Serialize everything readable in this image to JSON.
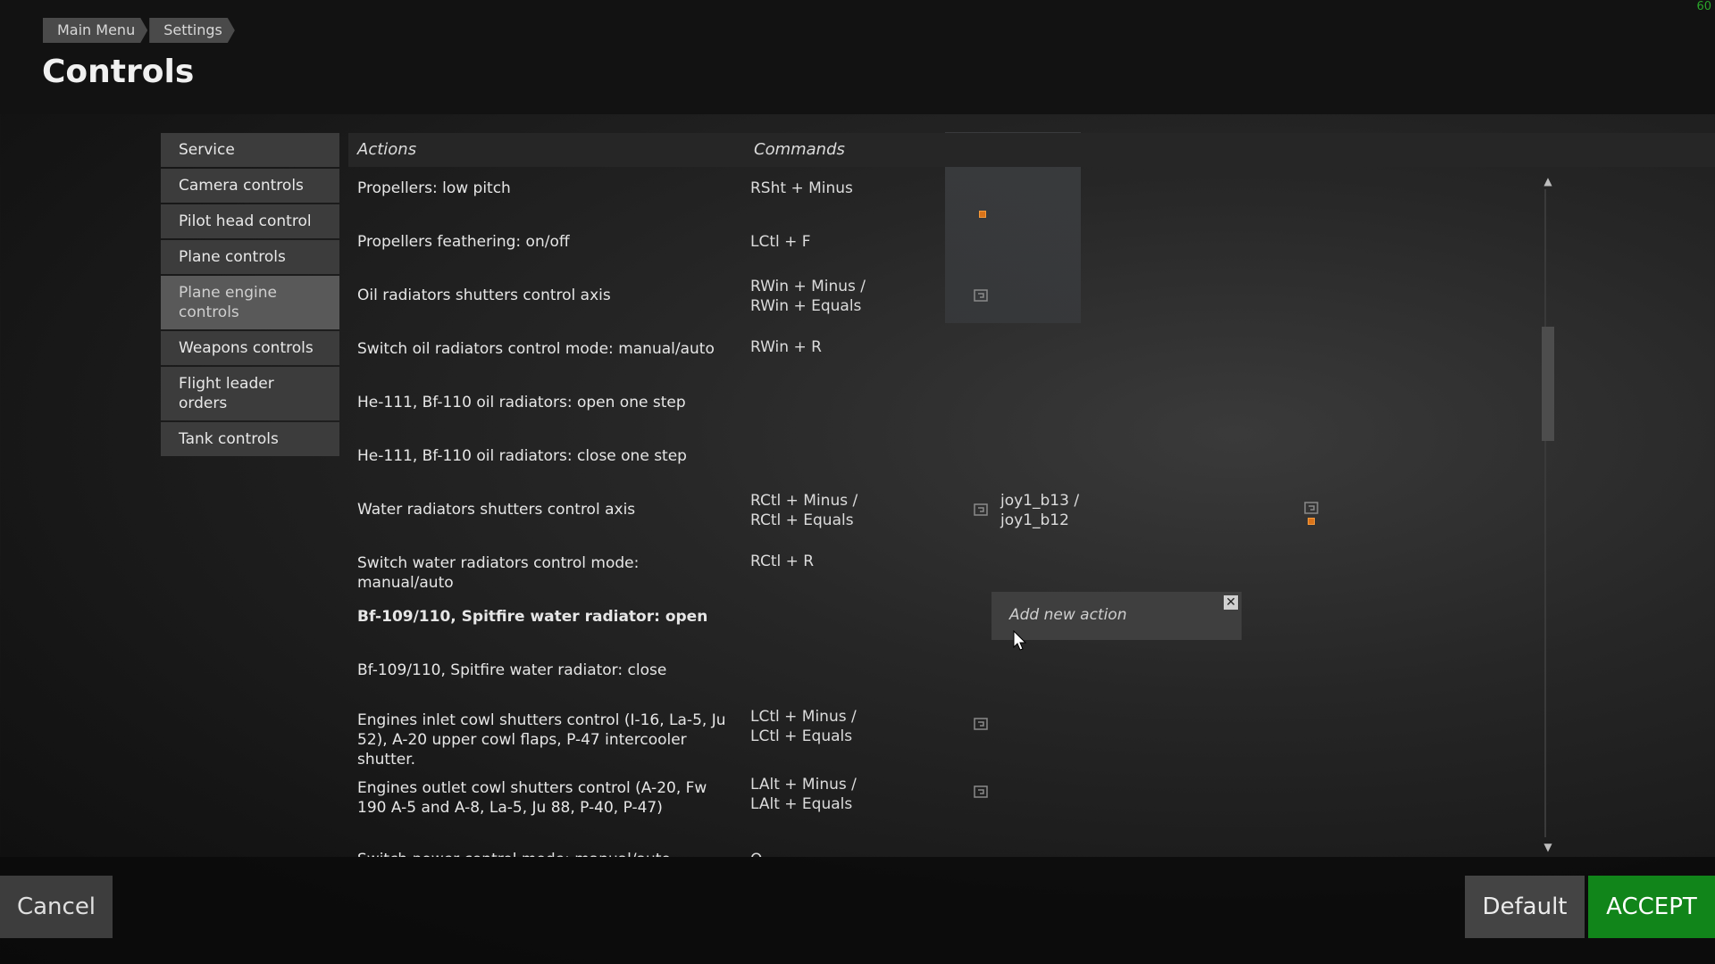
{
  "fps": "60",
  "breadcrumb": [
    "Main Menu",
    "Settings"
  ],
  "title": "Controls",
  "sidebar": [
    {
      "label": "Service",
      "active": false
    },
    {
      "label": "Camera controls",
      "active": false
    },
    {
      "label": "Pilot head control",
      "active": false
    },
    {
      "label": "Plane controls",
      "active": false
    },
    {
      "label": "Plane engine controls",
      "active": true
    },
    {
      "label": "Weapons controls",
      "active": false
    },
    {
      "label": "Flight leader orders",
      "active": false
    },
    {
      "label": "Tank controls",
      "active": false
    }
  ],
  "columns": {
    "actions": "Actions",
    "commands": "Commands"
  },
  "rows": [
    {
      "action": "Propellers: low pitch",
      "cmd": "RSht + Minus",
      "cmd2": ""
    },
    {
      "action": "Propellers feathering: on/off",
      "cmd": "LCtl + F",
      "cmd2": ""
    },
    {
      "action": "Oil radiators shutters control axis",
      "cmd": "RWin + Minus /\nRWin + Equals",
      "cmd2": ""
    },
    {
      "action": "Switch oil radiators control mode: manual/auto",
      "cmd": "RWin + R",
      "cmd2": ""
    },
    {
      "action": "He-111, Bf-110 oil radiators: open one step",
      "cmd": "",
      "cmd2": ""
    },
    {
      "action": "He-111, Bf-110 oil radiators: close one step",
      "cmd": "",
      "cmd2": ""
    },
    {
      "action": "Water radiators shutters control axis",
      "cmd": "RCtl + Minus /\nRCtl + Equals",
      "cmd2": "joy1_b13 /\njoy1_b12"
    },
    {
      "action": "Switch water radiators control mode: manual/auto",
      "cmd": "RCtl + R",
      "cmd2": ""
    },
    {
      "action": "Bf-109/110, Spitfire water radiator: open",
      "cmd": "",
      "cmd2": ""
    },
    {
      "action": "Bf-109/110, Spitfire water radiator: close",
      "cmd": "",
      "cmd2": ""
    },
    {
      "action": "Engines inlet cowl shutters control (I-16, La-5, Ju 52), A-20 upper cowl flaps, P-47 intercooler shutter.",
      "cmd": "LCtl + Minus /\nLCtl + Equals",
      "cmd2": ""
    },
    {
      "action": "Engines outlet cowl shutters control (A-20, Fw 190 A-5 and A-8, La-5, Ju 88, P-40, P-47)",
      "cmd": "LAlt + Minus /\nLAlt + Equals",
      "cmd2": ""
    },
    {
      "action": "Switch power control mode: manual/auto",
      "cmd": "Q",
      "cmd2": ""
    }
  ],
  "popup": {
    "label": "Add new action",
    "close": "✕"
  },
  "buttons": {
    "cancel": "Cancel",
    "default": "Default",
    "accept": "ACCEPT"
  },
  "colors": {
    "accept": "#11851a",
    "warning": "#d9731a"
  }
}
